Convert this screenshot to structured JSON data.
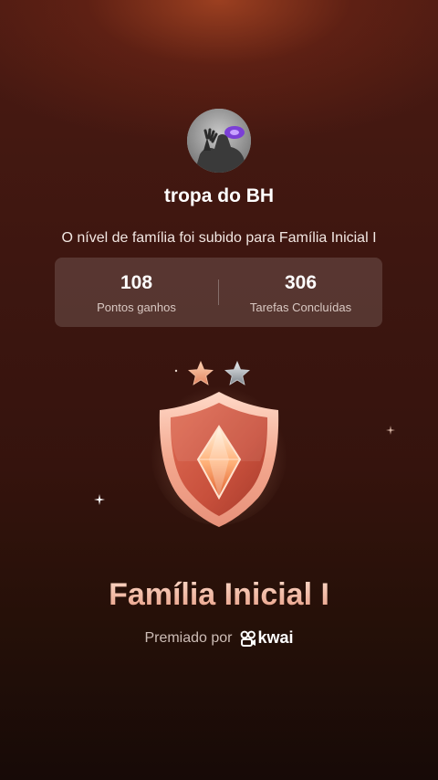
{
  "profile": {
    "username": "tropa do BH"
  },
  "message": "O nível de família foi subido para Família Inicial I",
  "stats": [
    {
      "value": "108",
      "label": "Pontos ganhos"
    },
    {
      "value": "306",
      "label": "Tarefas Concluídas"
    }
  ],
  "medal": {
    "stars_earned": 1,
    "stars_total": 2,
    "title": "Família Inicial I"
  },
  "awarded": {
    "label": "Premiado por",
    "brand": "kwai"
  },
  "colors": {
    "background_top": "#4a1a12",
    "background_bottom": "#170a07",
    "medal_accent": "#e8917a",
    "title_gradient": "#f0b7a0"
  }
}
